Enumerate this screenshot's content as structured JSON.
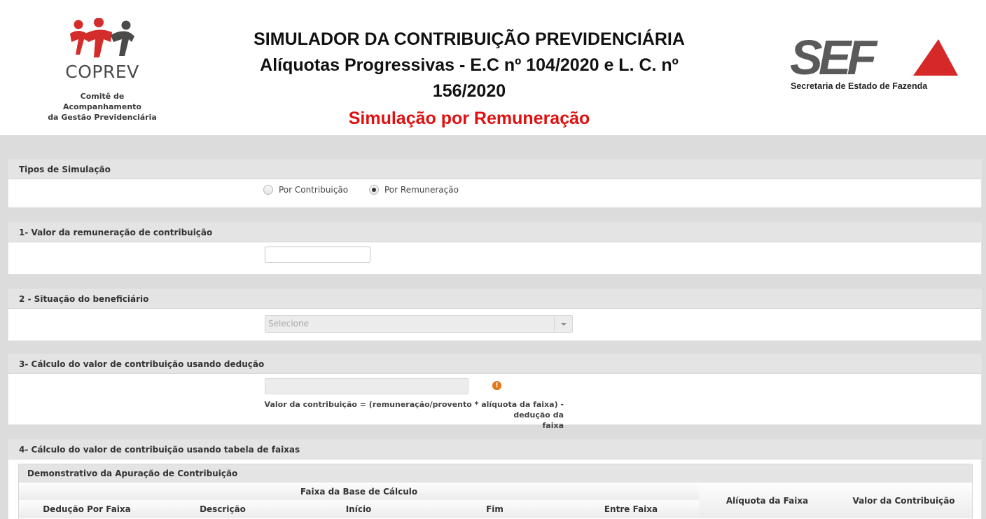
{
  "header": {
    "coprev": {
      "name": "COPREV",
      "line1": "Comitê de Acompanhamento",
      "line2": "da Gestão Previdenciária"
    },
    "title_line1": "SIMULADOR DA CONTRIBUIÇÃO PREVIDENCIÁRIA",
    "title_line2": "Alíquotas Progressivas - E.C nº 104/2020 e L. C. nº",
    "title_line3": "156/2020",
    "subtitle": "Simulação por Remuneração",
    "sef": {
      "mark": "SEF",
      "tagline": "Secretaria de Estado de Fazenda"
    }
  },
  "colors": {
    "subtitle_red": "#e01010",
    "coprev_red": "#d42b2b",
    "coprev_gray": "#4a4a4a",
    "sef_gray": "#5a5a5a",
    "sef_red": "#d62828",
    "warn_orange": "#e0781a"
  },
  "tipos": {
    "heading": "Tipos de Simulação",
    "options": [
      {
        "label": "Por Contribuição",
        "checked": false
      },
      {
        "label": "Por Remuneração",
        "checked": true
      }
    ]
  },
  "section1": {
    "heading": "1- Valor da remuneração de contribuição",
    "value": ""
  },
  "section2": {
    "heading": "2 - Situação do beneficiário",
    "placeholder": "Selecione"
  },
  "section3": {
    "heading": "3- Cálculo do valor de contribuição usando dedução",
    "value": "",
    "warn_icon": "exclamation-icon",
    "formula_line1": "Valor da contribuição = (remuneração/provento * alíquota da faixa) - dedução da",
    "formula_line2": "faixa"
  },
  "section4": {
    "heading": "4- Cálculo do valor de contribuição usando tabela de faixas",
    "table_title": "Demonstrativo da Apuração de Contribuição",
    "group_header": "Faixa da Base de Cálculo",
    "columns": [
      "Dedução Por Faixa",
      "Descrição",
      "Início",
      "Fim",
      "Entre Faixa"
    ],
    "aliquota_header": "Alíquota da Faixa",
    "valor_header": "Valor da Contribuição"
  }
}
